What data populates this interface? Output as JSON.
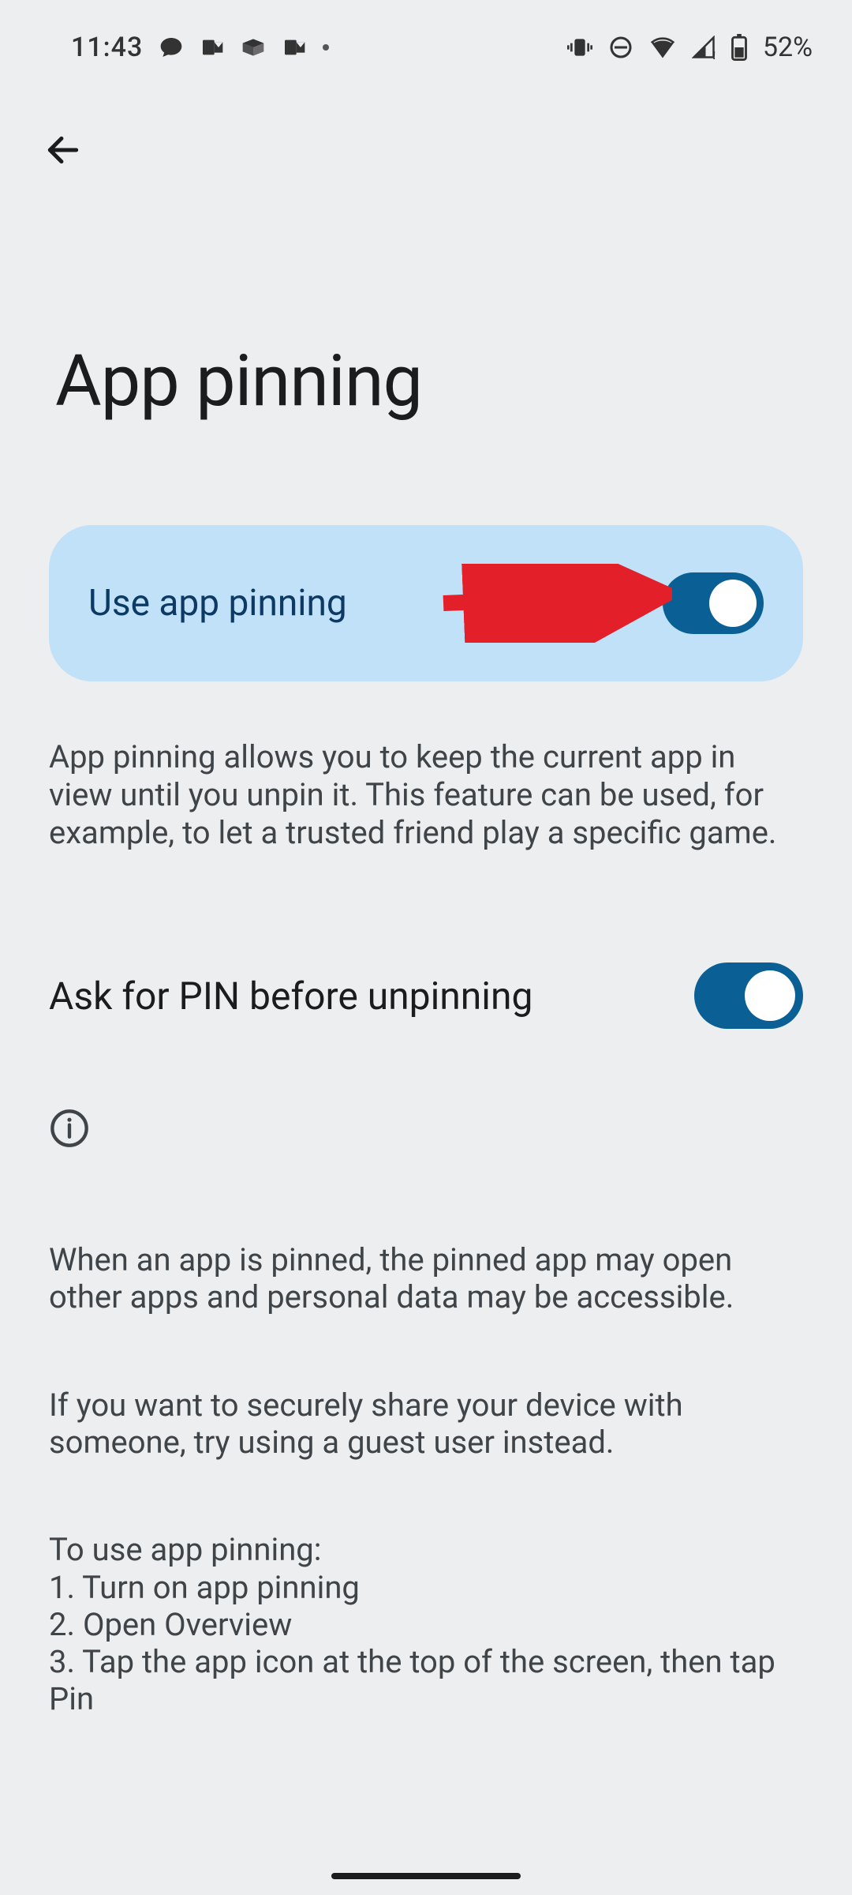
{
  "status": {
    "time": "11:43",
    "battery": "52%"
  },
  "page": {
    "title": "App pinning"
  },
  "primary_toggle": {
    "label": "Use app pinning",
    "on": true
  },
  "description": "App pinning allows you to keep the current app in view until you unpin it. This feature can be used, for example, to let a trusted friend play a specific game.",
  "secondary_toggle": {
    "label": "Ask for PIN before unpinning",
    "on": true
  },
  "info": {
    "p1": "When an app is pinned, the pinned app may open other apps and personal data may be accessible.",
    "p2": "If you want to securely share your device with someone, try using a guest user instead.",
    "p3": "To use app pinning:\n1. Turn on app pinning\n2. Open Overview\n3. Tap the app icon at the top of the screen, then tap Pin"
  }
}
